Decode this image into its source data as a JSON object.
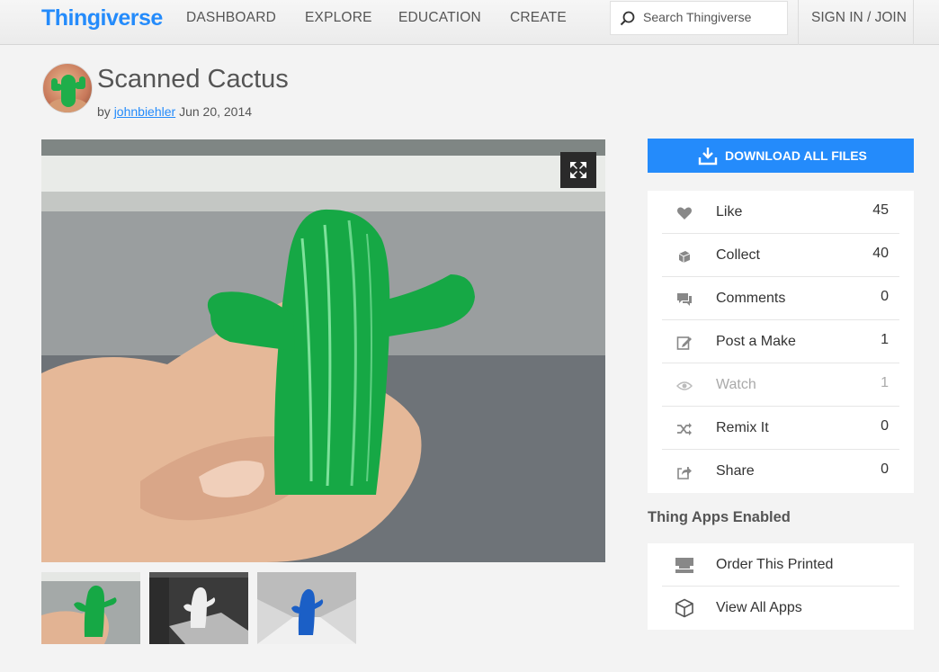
{
  "nav": {
    "logo": "Thingiverse",
    "links": [
      "DASHBOARD",
      "EXPLORE",
      "EDUCATION",
      "CREATE"
    ],
    "search_placeholder": "Search Thingiverse",
    "signin": "SIGN IN / JOIN"
  },
  "thing": {
    "title": "Scanned Cactus",
    "by_prefix": "by",
    "author": "johnbiehler",
    "date": "Jun 20, 2014"
  },
  "download_label": "DOWNLOAD ALL FILES",
  "stats": [
    {
      "label": "Like",
      "count": "45",
      "icon": "heart-icon"
    },
    {
      "label": "Collect",
      "count": "40",
      "icon": "collect-icon"
    },
    {
      "label": "Comments",
      "count": "0",
      "icon": "comment-icon"
    },
    {
      "label": "Post a Make",
      "count": "1",
      "icon": "edit-icon"
    },
    {
      "label": "Watch",
      "count": "1",
      "icon": "eye-icon"
    },
    {
      "label": "Remix It",
      "count": "0",
      "icon": "shuffle-icon"
    },
    {
      "label": "Share",
      "count": "0",
      "icon": "share-icon"
    }
  ],
  "apps": {
    "heading": "Thing Apps Enabled",
    "items": [
      {
        "label": "Order This Printed",
        "icon": "printer-icon"
      },
      {
        "label": "View All Apps",
        "icon": "cube-icon"
      }
    ]
  },
  "colors": {
    "accent": "#248bfb",
    "background": "#f3f3f3",
    "cactus": "#1fae4a"
  }
}
